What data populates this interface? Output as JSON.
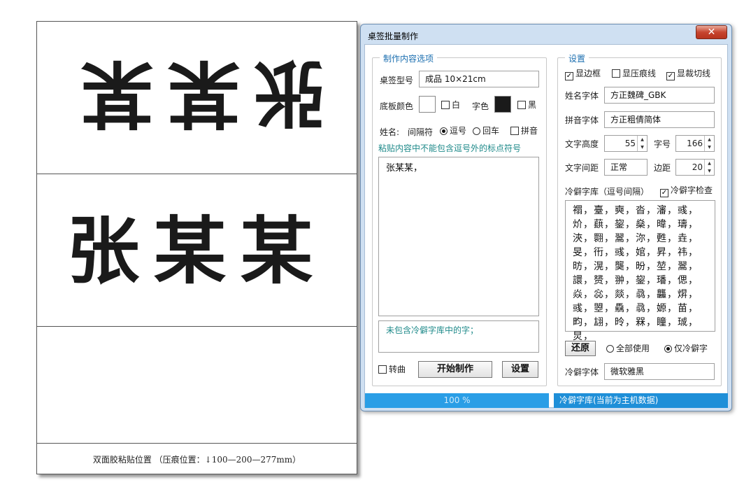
{
  "preview": {
    "top_name": "张某某",
    "mid_name": "张某某",
    "glue_note": "双面胶粘贴位置 （压痕位置：↓100—200—277mm）"
  },
  "window": {
    "title": "桌签批量制作",
    "close_glyph": "✕"
  },
  "make_options": {
    "group_title": "制作内容选项",
    "model_label": "桌签型号",
    "model_value": "成品 10×21cm",
    "board_color_label": "底板颜色",
    "board_color_check": "白",
    "board_color_checked": false,
    "board_color_hex": "#ffffff",
    "font_color_label": "字色",
    "font_color_check": "黑",
    "font_color_checked": false,
    "font_color_hex": "#1a1a1a",
    "names_label": "姓名:",
    "separator_label": "间隔符",
    "sep_comma": "逗号",
    "sep_return": "回车",
    "sep_selected": "comma",
    "pinyin_label": "拼音",
    "pinyin_checked": false,
    "paste_notice": "粘贴内容中不能包含逗号外的标点符号",
    "names_text": "张某某，",
    "missing_notice": "未包含冷僻字库中的字；",
    "traditional_label": "转曲",
    "traditional_checked": false,
    "start_button": "开始制作",
    "settings_button": "设置"
  },
  "settings": {
    "group_title": "设置",
    "show_border_label": "显边框",
    "show_border_checked": true,
    "show_crease_label": "显压痕线",
    "show_crease_checked": false,
    "show_cut_label": "显裁切线",
    "show_cut_checked": true,
    "name_font_label": "姓名字体",
    "name_font_value": "方正魏碑_GBK",
    "pinyin_font_label": "拼音字体",
    "pinyin_font_value": "方正粗倩简体",
    "text_height_label": "文字高度",
    "text_height_value": "55",
    "font_size_label": "字号",
    "font_size_value": "166",
    "spacing_label": "文字间距",
    "spacing_value": "正常",
    "margin_label": "边距",
    "margin_value": "20",
    "rare_lib_label": "冷僻字库（逗号间隔）",
    "rare_check_label": "冷僻字检查",
    "rare_check_checked": true,
    "rare_chars": "禤，臺，奭，沓，瀋，彧，炌，蕻，鋆，燊，暐，璹，浹，翾，翯，沵，甦，垚，旻，衎，彧，婠，昇，祎，昉，滉，龑，昐，堃，翯，譞，赟，翀，鋆，璠，偲，焱，惢，燚，骉，龘，焺，彧，曌，驫，骉，嫄，苗，畇，翃，昤，槑，瞳，珹，炅，",
    "restore_button": "还原",
    "use_all_label": "全部使用",
    "rare_only_label": "仅冷僻字",
    "use_selected": "rare_only",
    "rare_font_label": "冷僻字体",
    "rare_font_value": "微软雅黑"
  },
  "status": {
    "progress_text": "100 %",
    "progress": 1.0,
    "right_text": "冷僻字库(当前为主机数据)"
  }
}
